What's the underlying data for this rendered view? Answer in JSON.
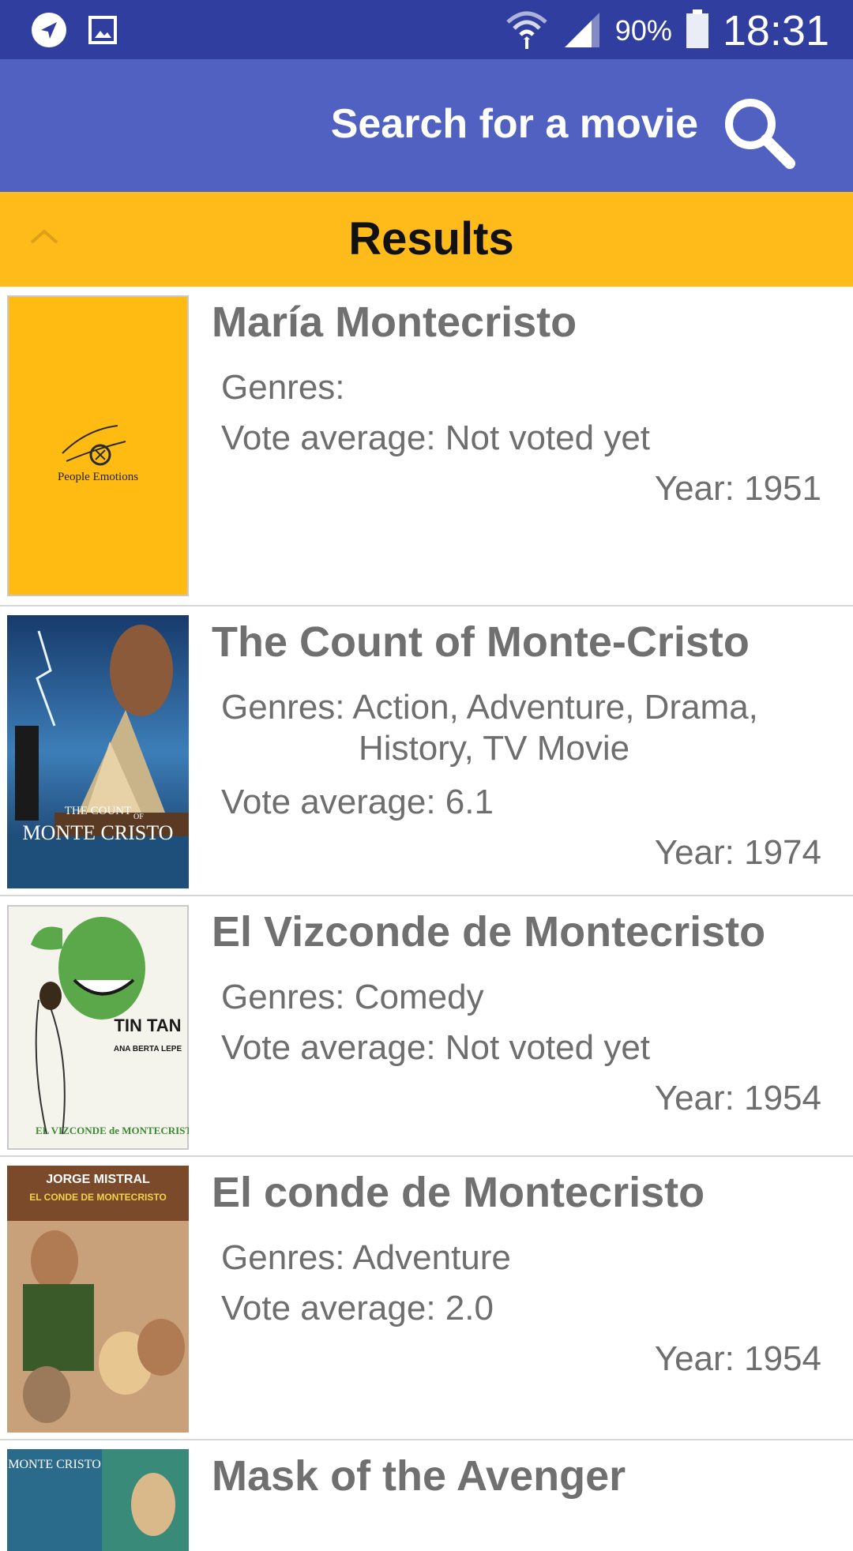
{
  "status_bar": {
    "battery": "90%",
    "time": "18:31"
  },
  "app_bar": {
    "title": "Search for a movie"
  },
  "results_bar": {
    "label": "Results"
  },
  "colors": {
    "status_bar": "#303f9f",
    "app_bar": "#5161c2",
    "results_bar": "#ffbb1a",
    "text_gray": "#707070"
  },
  "movies": [
    {
      "title": "María Montecristo",
      "genres_label": "Genres: ",
      "genres": "",
      "genres_cont": "",
      "vote": "Vote average: Not voted yet",
      "year": "Year: 1951",
      "poster_text": "People Emotions"
    },
    {
      "title": "The Count of Monte-Cristo",
      "genres_label": "Genres: ",
      "genres": "Action, Adventure, Drama,",
      "genres_cont": "History, TV Movie",
      "vote": "Vote average: 6.1",
      "year": "Year: 1974",
      "poster_text_1": "THE COUNT",
      "poster_text_2": "OF",
      "poster_text_3": "MONTE CRISTO"
    },
    {
      "title": "El Vizconde de Montecristo",
      "genres_label": "Genres: ",
      "genres": "Comedy",
      "genres_cont": "",
      "vote": "Vote average: Not voted yet",
      "year": "Year: 1954",
      "poster_text_1": "TIN TAN",
      "poster_text_2": "ANA BERTA LEPE",
      "poster_text_3": "EL VIZCONDE de MONTECRISTO"
    },
    {
      "title": "El conde de Montecristo",
      "genres_label": "Genres: ",
      "genres": "Adventure",
      "genres_cont": "",
      "vote": "Vote average: 2.0",
      "year": "Year: 1954",
      "poster_text_1": "JORGE MISTRAL",
      "poster_text_2": "EL CONDE DE MONTECRISTO"
    },
    {
      "title": "Mask of the Avenger",
      "poster_text_1": "MONTE CRISTO"
    }
  ]
}
